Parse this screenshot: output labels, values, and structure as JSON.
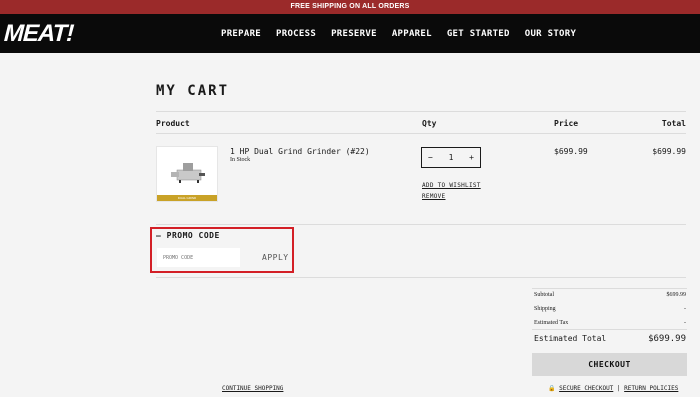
{
  "promo_bar": "FREE SHIPPING ON ALL ORDERS",
  "logo": "MEAT!",
  "nav": [
    "PREPARE",
    "PROCESS",
    "PRESERVE",
    "APPAREL",
    "GET STARTED",
    "OUR STORY"
  ],
  "cart": {
    "title": "MY CART",
    "headers": {
      "product": "Product",
      "qty": "Qty",
      "price": "Price",
      "total": "Total"
    },
    "item": {
      "name": "1 HP Dual Grind Grinder (#22)",
      "stock": "In Stock",
      "band_text": "DUAL GRIND",
      "qty": "1",
      "minus": "−",
      "plus": "+",
      "add_to_wishlist": "ADD TO WISHLIST",
      "remove": "REMOVE",
      "price": "$699.99",
      "total": "$699.99"
    }
  },
  "promo": {
    "heading": "— PROMO CODE",
    "placeholder": "PROMO CODE",
    "apply": "APPLY"
  },
  "summary": {
    "subtotal_label": "Subtotal",
    "subtotal_value": "$699.99",
    "shipping_label": "Shipping",
    "shipping_value": "-",
    "tax_label": "Estimated Tax",
    "tax_value": "-",
    "estimated_total_label": "Estimated Total",
    "estimated_total_value": "$699.99",
    "checkout": "CHECKOUT"
  },
  "footer": {
    "continue_shopping": "CONTINUE SHOPPING",
    "secure_checkout": "SECURE CHECKOUT",
    "separator": "|",
    "return_policies": "RETURN POLICIES"
  },
  "colors": {
    "promo_bar": "#9b2a2a",
    "header": "#0a0a0a",
    "highlight": "#d31f26",
    "checkout_bg": "#d8d8d8"
  }
}
